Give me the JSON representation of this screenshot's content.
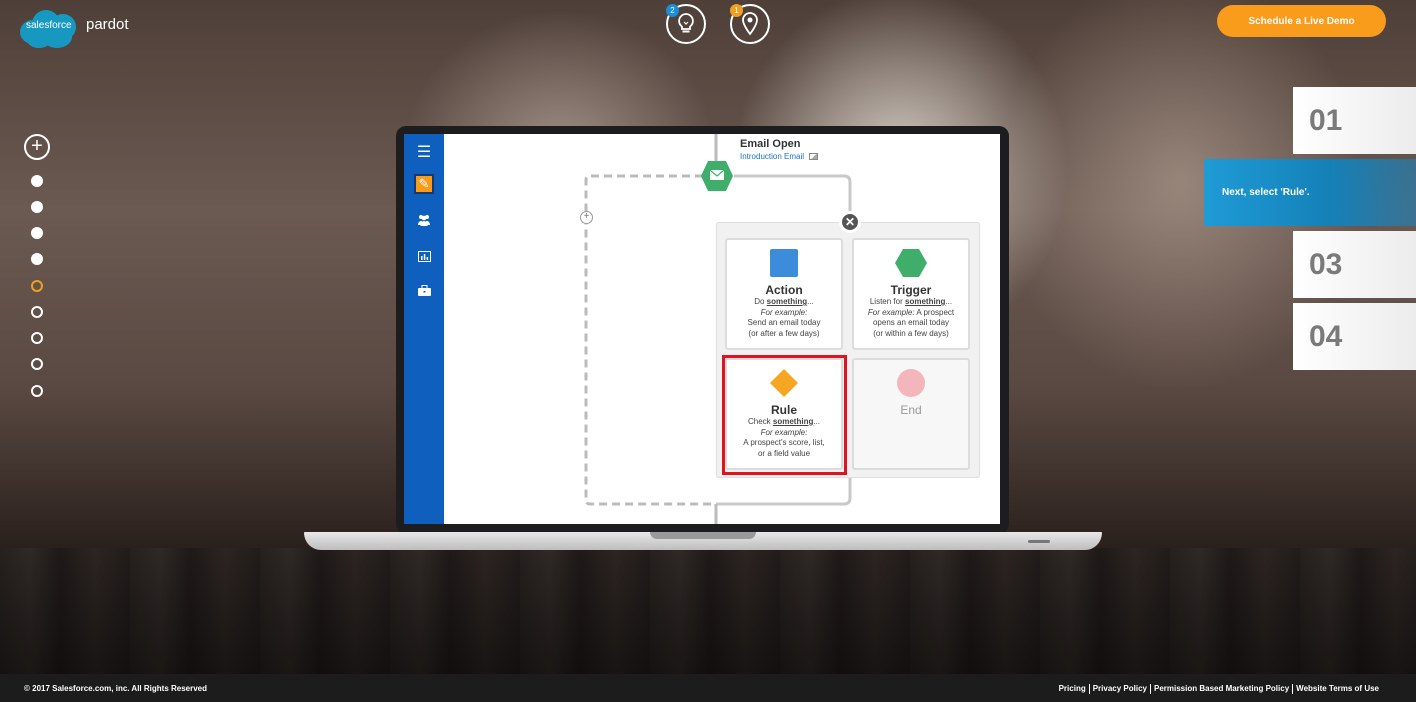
{
  "brand": {
    "cloud_text": "salesforce",
    "product": "pardot"
  },
  "top_icons": [
    {
      "name": "lightbulb",
      "badge": "2",
      "badge_color": "#1a8fd8"
    },
    {
      "name": "location-pin",
      "badge": "1",
      "badge_color": "#f0a020"
    }
  ],
  "header": {
    "demo_label": "Schedule a Live Demo",
    "accent": "#f99b1b"
  },
  "steps": [
    {
      "label": "01"
    },
    {
      "label": "Next, select 'Rule'."
    },
    {
      "label": "03"
    },
    {
      "label": "04"
    }
  ],
  "progress": {
    "total_dots": 9,
    "completed": 4,
    "current_index": 5
  },
  "app": {
    "node_title": "Email Open",
    "node_link": "Introduction Email",
    "cards": {
      "action": {
        "title": "Action",
        "line1_prefix": "Do ",
        "line1_link": "something",
        "line1_suffix": "...",
        "example": "For example:",
        "desc1": "Send an email today",
        "desc2": "(or after a few days)",
        "color": "#3d8bdb"
      },
      "trigger": {
        "title": "Trigger",
        "line1_prefix": "Listen for ",
        "line1_link": "something",
        "line1_suffix": "...",
        "example": "For example:",
        "desc_inline": " A prospect",
        "desc1": "opens an email today",
        "desc2": "(or within a few days)",
        "color": "#3fae6a"
      },
      "rule": {
        "title": "Rule",
        "line1_prefix": "Check ",
        "line1_link": "something",
        "line1_suffix": "...",
        "example": "For example:",
        "desc1": "A prospect's score, list,",
        "desc2": "or a field value",
        "color": "#f5a623"
      },
      "end": {
        "title": "End",
        "color": "#f2b6bb"
      }
    }
  },
  "footer": {
    "copyright": "© 2017 Salesforce.com, inc. All Rights Reserved",
    "links": [
      "Pricing",
      "Privacy Policy",
      "Permission Based Marketing Policy",
      "Website Terms of Use"
    ]
  }
}
